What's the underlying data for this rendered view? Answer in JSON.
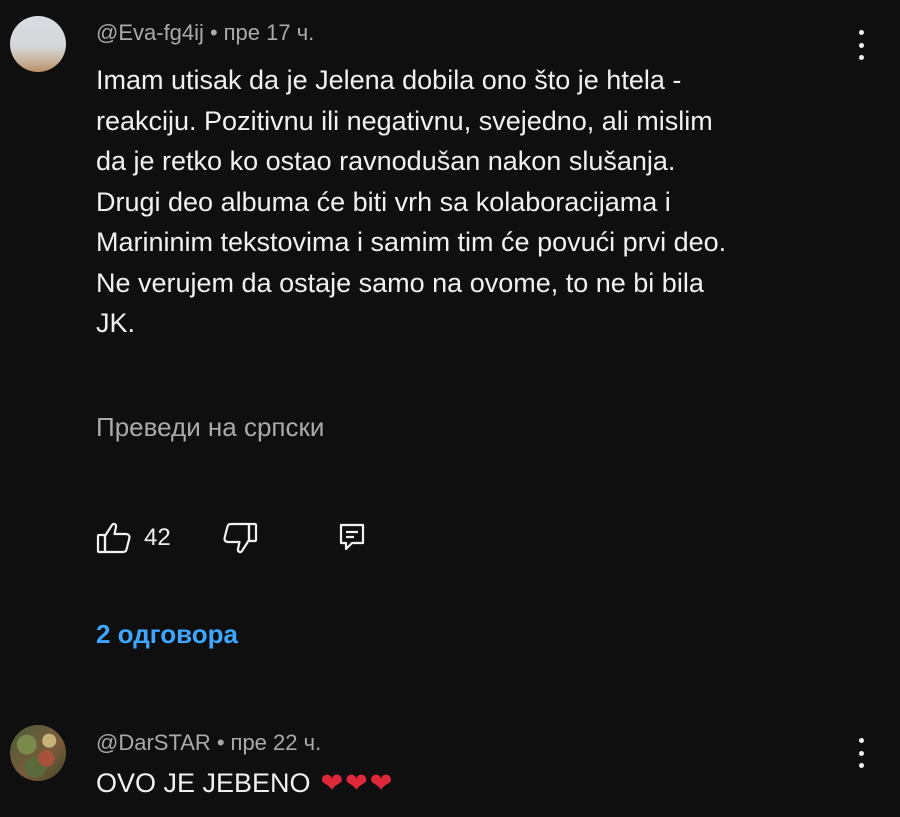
{
  "comments": [
    {
      "author": "@Eva-fg4ij",
      "separator": "•",
      "time": "пре 17 ч.",
      "lines": [
        "Imam utisak da je Jelena dobila ono što je htela -",
        "reakciju. Pozitivnu ili negativnu, svejedno, ali mislim",
        "da je retko ko ostao ravnodušan nakon slušanja.",
        "Drugi deo albuma će biti vrh sa kolaboracijama i",
        "Marininim tekstovima i samim tim će povući prvi deo.",
        "Ne verujem da ostaje samo na ovome, to ne bi bila",
        "JK."
      ],
      "translate_label": "Преведи на српски",
      "like_count": "42",
      "replies_label": "2 одговора",
      "icons": {
        "like": "thumbs-up-icon",
        "dislike": "thumbs-down-icon",
        "reply": "reply-icon",
        "menu": "more-vertical-icon"
      }
    },
    {
      "author": "@DarSTAR",
      "separator": "•",
      "time": "пре 22 ч.",
      "text": "OVO JE JEBENO",
      "emoji": "❤❤❤",
      "icons": {
        "menu": "more-vertical-icon"
      }
    }
  ],
  "colors": {
    "background": "#0f0f0f",
    "text": "#f1f1f1",
    "secondary_text": "#aaaaaa",
    "link": "#3ea6ff",
    "heart": "#e0283b"
  }
}
